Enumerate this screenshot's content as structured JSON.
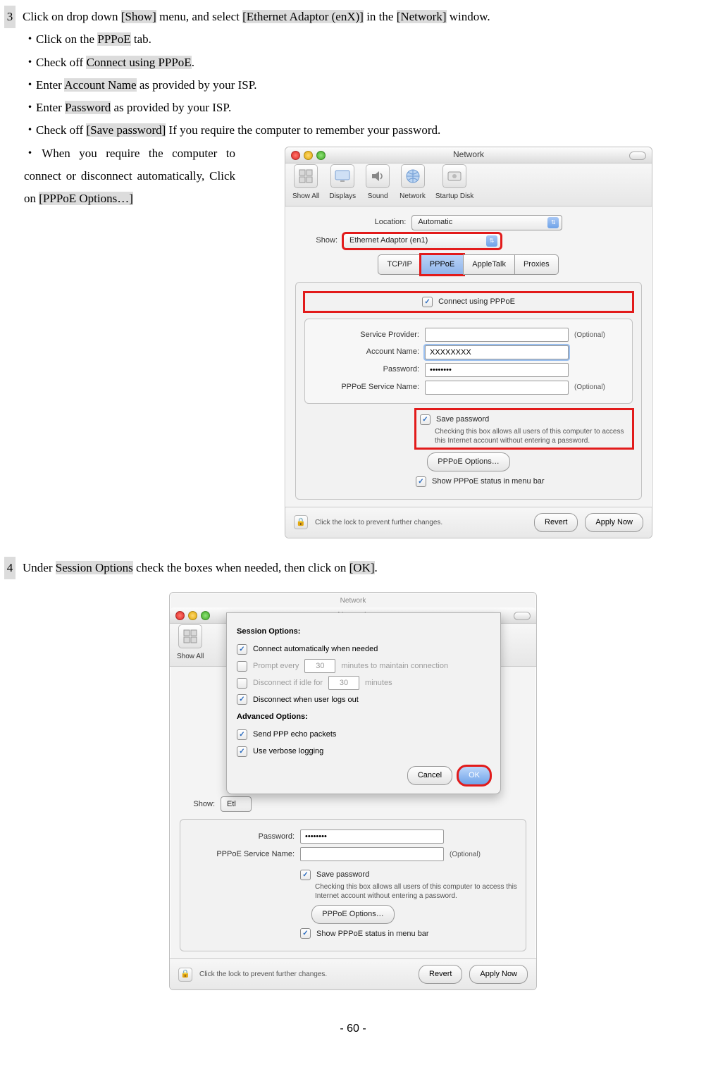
{
  "doc": {
    "step3_num": "3",
    "step3_text_a": "Click on drop down ",
    "step3_show": "[Show]",
    "step3_text_b": " menu, and select ",
    "step3_adaptor": "[Ethernet Adaptor (enX)]",
    "step3_text_c": " in the ",
    "step3_network": "[Network]",
    "step3_text_d": " window.",
    "sub_a_pre": "・Click on the ",
    "sub_a_hl": "PPPoE",
    "sub_a_post": " tab.",
    "sub_b_pre": "・Check off ",
    "sub_b_hl": "Connect using PPPoE",
    "sub_b_post": ".",
    "sub_c_pre": "・Enter ",
    "sub_c_hl": "Account Name",
    "sub_c_post": " as provided by your ISP.",
    "sub_d_pre": "・Enter ",
    "sub_d_hl": "Password",
    "sub_d_post": " as provided by your ISP.",
    "sub_e_pre": "・Check off ",
    "sub_e_hl": "[Save password]",
    "sub_e_post": " If you require the computer to remember your password.",
    "sub_f_pre": "・When you require the computer to connect or disconnect automatically, Click on ",
    "sub_f_hl": "[PPPoE Options…]",
    "step4_num": "4",
    "step4_text_a": "Under ",
    "step4_hl": "Session Options",
    "step4_text_b": " check the boxes when needed, then click on ",
    "step4_ok": "[OK]",
    "step4_text_c": ".",
    "page": "- 60 -"
  },
  "win1": {
    "title": "Network",
    "toolbar": {
      "show_all": "Show All",
      "displays": "Displays",
      "sound": "Sound",
      "network": "Network",
      "startup": "Startup Disk"
    },
    "location_label": "Location:",
    "location_value": "Automatic",
    "show_label": "Show:",
    "show_value": "Ethernet Adaptor (en1)",
    "tabs": {
      "tcpip": "TCP/IP",
      "pppoe": "PPPoE",
      "appletalk": "AppleTalk",
      "proxies": "Proxies"
    },
    "connect_cb": "Connect using PPPoE",
    "fields": {
      "service_provider_label": "Service Provider:",
      "account_label": "Account Name:",
      "account_value": "XXXXXXXX",
      "password_label": "Password:",
      "password_value": "••••••••",
      "pppoe_service_label": "PPPoE Service Name:",
      "optional": "(Optional)"
    },
    "save_pw": "Save password",
    "save_pw_note": "Checking this box allows all users of this computer to access this Internet account without entering a password.",
    "options_btn": "PPPoE Options…",
    "show_status": "Show PPPoE status in menu bar",
    "lock_text": "Click the lock to prevent further changes.",
    "revert": "Revert",
    "apply": "Apply Now"
  },
  "win2": {
    "title": "Network",
    "ghost_title": "Network",
    "sheet": {
      "session": "Session Options:",
      "o1": "Connect automatically when needed",
      "o2a": "Prompt every",
      "o2_val": "30",
      "o2b": "minutes to maintain connection",
      "o3a": "Disconnect if idle for",
      "o3_val": "30",
      "o3b": "minutes",
      "o4": "Disconnect when user logs out",
      "adv": "Advanced Options:",
      "a1": "Send PPP echo packets",
      "a2": "Use verbose logging",
      "cancel": "Cancel",
      "ok": "OK"
    },
    "toolbar": {
      "show_all": "Show All"
    },
    "show_label": "Show:",
    "show_value_trunc": "Etl",
    "password_label": "Password:",
    "password_value": "••••••••",
    "pppoe_service_label": "PPPoE Service Name:",
    "optional": "(Optional)",
    "save_pw": "Save password",
    "save_pw_note": "Checking this box allows all users of this computer to access this Internet account without entering a password.",
    "options_btn": "PPPoE Options…",
    "show_status": "Show PPPoE status in menu bar",
    "lock_text": "Click the lock to prevent further changes.",
    "revert": "Revert",
    "apply": "Apply Now"
  }
}
